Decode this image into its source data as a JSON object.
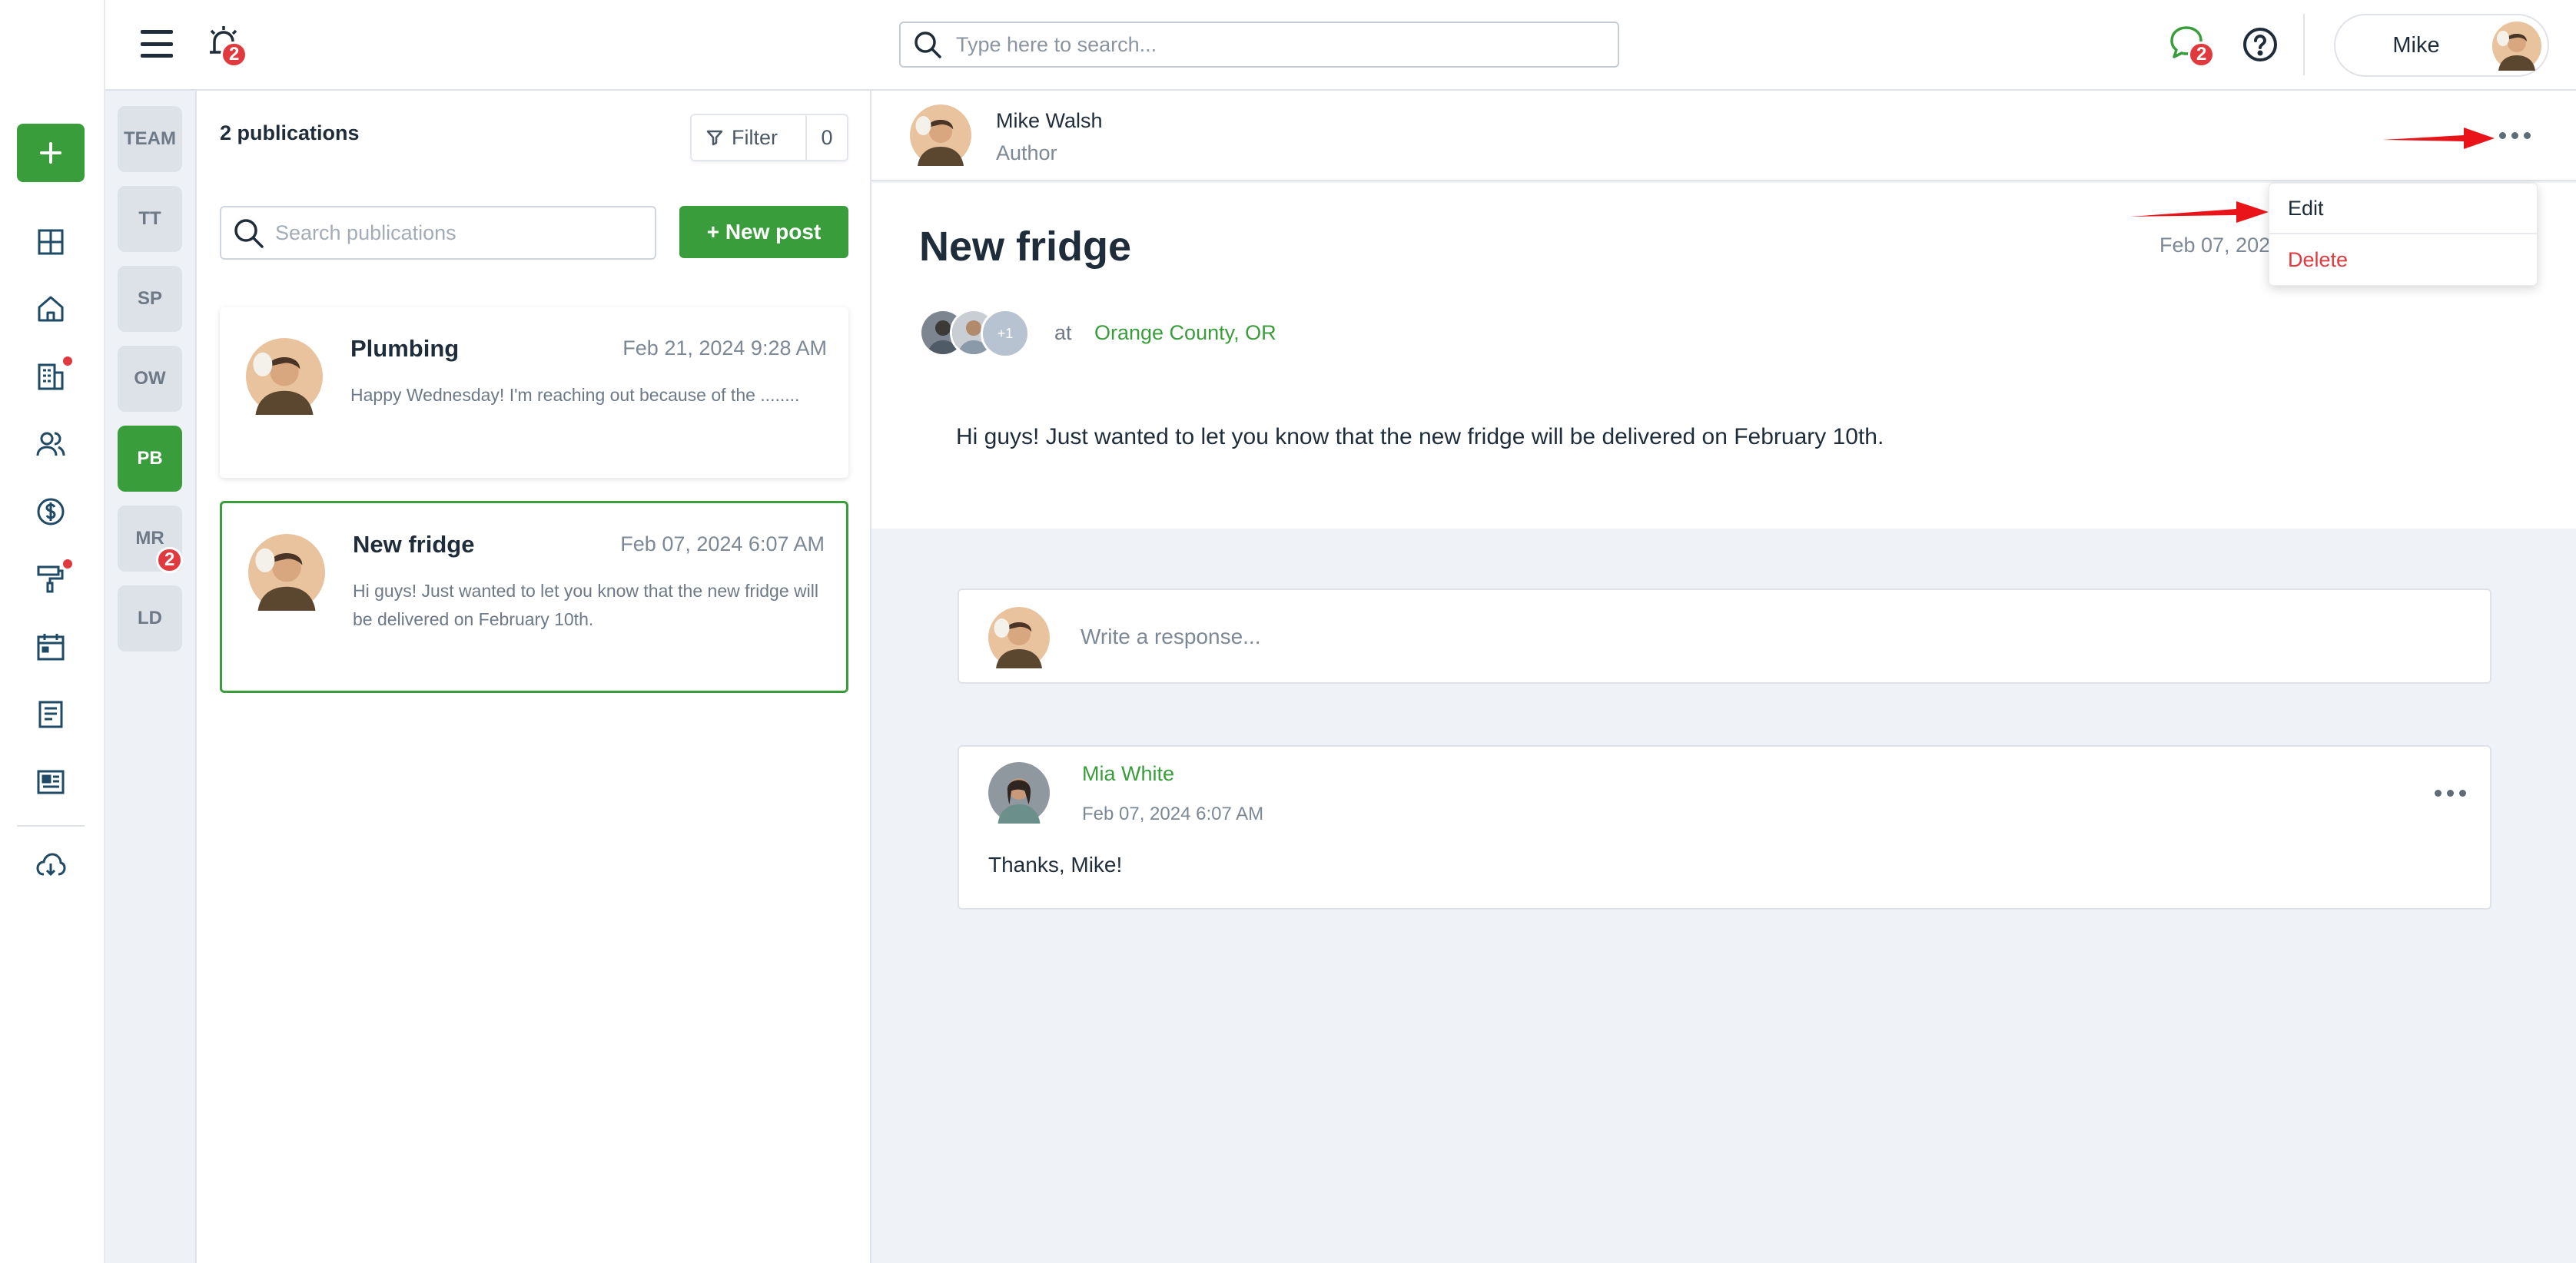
{
  "header": {
    "notification_count": "2",
    "search_placeholder": "Type here to search...",
    "chat_count": "2",
    "user_name": "Mike"
  },
  "rail": {
    "icons": [
      "plus-icon",
      "dashboard-icon",
      "home-icon",
      "building-icon",
      "people-icon",
      "dollar-icon",
      "paint-roller-icon",
      "calendar-icon",
      "document-icon",
      "newspaper-icon",
      "download-cloud-icon"
    ]
  },
  "teams": [
    "TEAM",
    "TT",
    "SP",
    "OW",
    "PB",
    "MR",
    "LD"
  ],
  "team_badge_mr": "2",
  "publications": {
    "count_label": "2 publications",
    "filter_label": "Filter",
    "filter_count": "0",
    "search_placeholder": "Search publications",
    "new_post_label": "+ New post",
    "items": [
      {
        "title": "Plumbing",
        "date": "Feb 21, 2024 9:28 AM",
        "excerpt": "Happy Wednesday! I'm reaching out because of the ........"
      },
      {
        "title": "New fridge",
        "date": "Feb 07, 2024 6:07 AM",
        "excerpt": "Hi guys! Just wanted to let you know that the new fridge will be delivered on February 10th."
      }
    ]
  },
  "detail": {
    "author_name": "Mike Walsh",
    "author_role": "Author",
    "title": "New fridge",
    "date": "Feb 07, 202",
    "extra_attendees": "+1",
    "at_label": "at",
    "location": "Orange County, OR",
    "body": "Hi guys! Just wanted to let you know that the new fridge will be delivered on February 10th.",
    "response_placeholder": "Write a response...",
    "comment": {
      "author": "Mia White",
      "date": "Feb 07, 2024 6:07 AM",
      "text": "Thanks, Mike!"
    }
  },
  "menu": {
    "edit_label": "Edit",
    "delete_label": "Delete"
  },
  "colors": {
    "accent": "#3a9d3c",
    "danger": "#e0393e",
    "annotation_arrow": "#e8141a"
  }
}
